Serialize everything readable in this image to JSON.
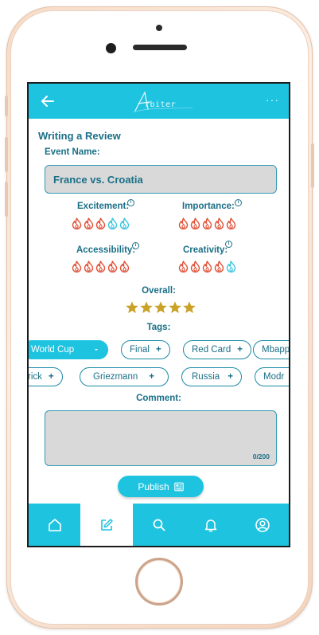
{
  "app": {
    "logo_text": "rbiter",
    "more_menu": "···"
  },
  "review": {
    "title": "Writing a Review",
    "event_label": "Event Name:",
    "event_value": "France vs. Croatia",
    "ratings": [
      {
        "label": "Excitement:",
        "value": 3,
        "max": 5
      },
      {
        "label": "Importance:",
        "value": 5,
        "max": 5
      },
      {
        "label": "Accessibility:",
        "value": 5,
        "max": 5
      },
      {
        "label": "Creativity:",
        "value": 4,
        "max": 5
      }
    ],
    "info_glyph": "i",
    "overall_label": "Overall:",
    "overall_stars": 5,
    "tags_label": "Tags:",
    "tags_row1": [
      {
        "label": "World Cup",
        "action": "-",
        "selected": true
      },
      {
        "label": "Final",
        "action": "+",
        "selected": false
      },
      {
        "label": "Red Card",
        "action": "+",
        "selected": false
      },
      {
        "label": "Mbappe",
        "action": "",
        "selected": false
      }
    ],
    "tags_row2": [
      {
        "label": "rick",
        "action": "+",
        "selected": false
      },
      {
        "label": "Griezmann",
        "action": "+",
        "selected": false
      },
      {
        "label": "Russia",
        "action": "+",
        "selected": false
      },
      {
        "label": "Modr",
        "action": "",
        "selected": false
      }
    ],
    "comment_label": "Comment:",
    "comment_counter": "0/200",
    "publish_label": "Publish"
  },
  "nav": {
    "items": [
      {
        "icon": "home-icon",
        "active": false
      },
      {
        "icon": "edit-icon",
        "active": true
      },
      {
        "icon": "search-icon",
        "active": false
      },
      {
        "icon": "bell-icon",
        "active": false
      },
      {
        "icon": "profile-icon",
        "active": false
      }
    ]
  },
  "colors": {
    "accent": "#1ec3e0",
    "text": "#1a6f87",
    "flame_active": "#e0533a",
    "flame_inactive": "#3cc7de",
    "star": "#c9a227"
  }
}
